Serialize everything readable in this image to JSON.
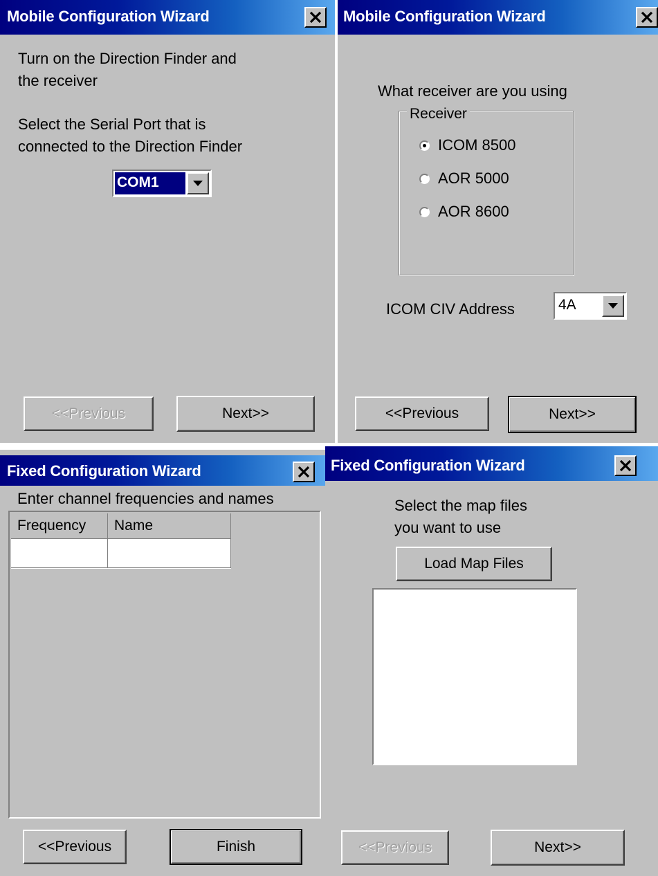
{
  "windows": {
    "mobile_port": {
      "title": "Mobile Configuration Wizard",
      "instruction_1": "Turn on the Direction Finder and",
      "instruction_2": "the receiver",
      "serial_label_1": "Select the Serial Port that is",
      "serial_label_2": "connected to the Direction Finder",
      "port_value": "COM1",
      "previous_label": "<<Previous",
      "next_label": "Next>>"
    },
    "mobile_receiver": {
      "title": "Mobile Configuration Wizard",
      "question": "What receiver are you using",
      "group_label": "Receiver",
      "options": [
        "ICOM 8500",
        "AOR 5000",
        "AOR 8600"
      ],
      "selected_option": "ICOM 8500",
      "civ_label": "ICOM CIV Address",
      "civ_value": "4A",
      "previous_label": "<<Previous",
      "next_label": "Next>>"
    },
    "fixed_channels": {
      "title": "Fixed Configuration Wizard",
      "instruction": "Enter channel frequencies and names",
      "columns": [
        "Frequency",
        "Name"
      ],
      "previous_label": "<<Previous",
      "finish_label": "Finish"
    },
    "fixed_maps": {
      "title": "Fixed Configuration Wizard",
      "instruction_1": "Select the map files",
      "instruction_2": "you want to use",
      "load_label": "Load Map Files",
      "previous_label": "<<Previous",
      "next_label": "Next>>"
    }
  },
  "colors": {
    "titlebar_start": "#000080",
    "titlebar_end": "#5aa8ee",
    "face": "#c0c0c0",
    "selection": "#000080"
  }
}
